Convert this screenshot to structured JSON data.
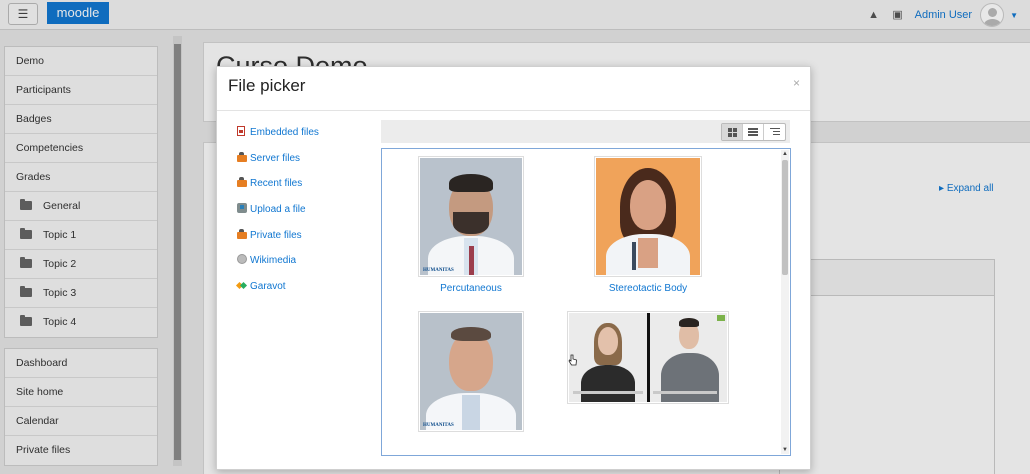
{
  "navbar": {
    "menu_icon": "hamburger-icon",
    "brand": "moodle",
    "user_name": "Admin User"
  },
  "sidebar": {
    "course_nav": [
      {
        "label": "Demo",
        "folder": false
      },
      {
        "label": "Participants",
        "folder": false
      },
      {
        "label": "Badges",
        "folder": false
      },
      {
        "label": "Competencies",
        "folder": false
      },
      {
        "label": "Grades",
        "folder": false
      },
      {
        "label": "General",
        "folder": true
      },
      {
        "label": "Topic 1",
        "folder": true
      },
      {
        "label": "Topic 2",
        "folder": true
      },
      {
        "label": "Topic 3",
        "folder": true
      },
      {
        "label": "Topic 4",
        "folder": true
      }
    ],
    "site_nav": [
      {
        "label": "Dashboard"
      },
      {
        "label": "Site home"
      },
      {
        "label": "Calendar"
      },
      {
        "label": "Private files"
      }
    ]
  },
  "page": {
    "course_title": "Curso Demo",
    "expand_all": "Expand all"
  },
  "file_picker": {
    "title": "File picker",
    "close": "×",
    "repositories": [
      {
        "label": "Embedded files",
        "icon": "embedded-files-icon"
      },
      {
        "label": "Server files",
        "icon": "server-files-icon"
      },
      {
        "label": "Recent files",
        "icon": "recent-files-icon"
      },
      {
        "label": "Upload a file",
        "icon": "upload-icon"
      },
      {
        "label": "Private files",
        "icon": "private-files-icon"
      },
      {
        "label": "Wikimedia",
        "icon": "wikimedia-icon"
      },
      {
        "label": "Garavot",
        "icon": "garavot-icon"
      }
    ],
    "view_modes": [
      "grid-view",
      "list-view",
      "tree-view"
    ],
    "active_view": "grid-view",
    "files": [
      {
        "label": "Percutaneous",
        "watermark": "HUMANITAS"
      },
      {
        "label": "Stereotactic Body",
        "watermark": ""
      },
      {
        "label": "",
        "watermark": "HUMANITAS"
      },
      {
        "label": "",
        "watermark": ""
      }
    ]
  },
  "colors": {
    "brand": "#1177d1",
    "link": "#1177d1"
  }
}
